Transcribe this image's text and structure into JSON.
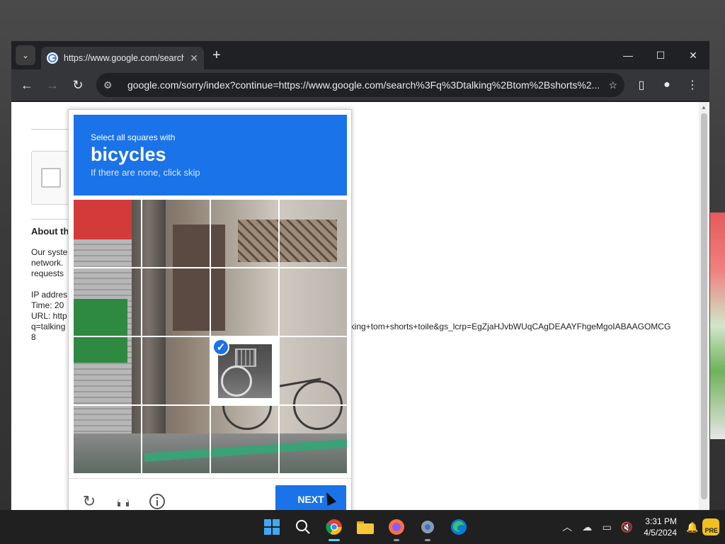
{
  "browser": {
    "tab_title": "https://www.google.com/search",
    "url": "google.com/sorry/index?continue=https://www.google.com/search%3Fq%3Dtalking%2Btom%2Bshorts%2..."
  },
  "page_bg": {
    "about_heading": "About th",
    "para_line1": "Our syste",
    "para_line2": "network.",
    "para_line3": "requests",
    "ip_label": "IP addres",
    "time_label": "Time: 20",
    "url_label": "URL: http",
    "url_q": "q=talking",
    "url_tail": "lking+tom+shorts+toile&gs_lcrp=EgZjaHJvbWUqCAgDEAAYFhgeMgoIABAAGOMCG",
    "url_last": "8"
  },
  "captcha": {
    "instruction": "Select all squares with",
    "target": "bicycles",
    "subtitle": "If there are none, click skip",
    "next_label": "NEXT",
    "selected_tile": "r3c3"
  },
  "taskbar": {
    "time": "3:31 PM",
    "date": "4/5/2024",
    "pre_badge": "PRE"
  }
}
